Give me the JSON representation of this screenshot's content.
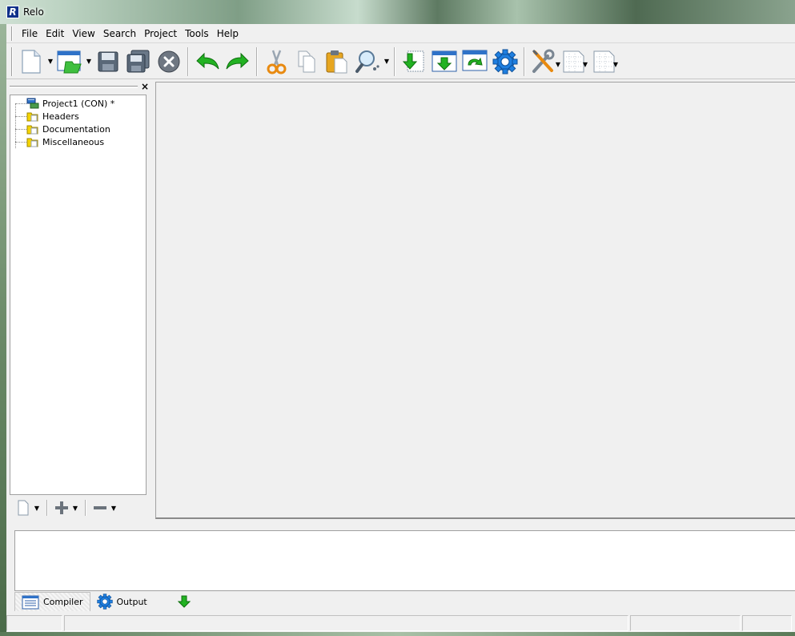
{
  "window": {
    "title": "Relo",
    "logo_letter": "R"
  },
  "menu": [
    "File",
    "Edit",
    "View",
    "Search",
    "Project",
    "Tools",
    "Help"
  ],
  "toolbar": {
    "buttons": [
      "new-file",
      "open-file",
      "save",
      "save-all",
      "close",
      "undo",
      "redo",
      "cut",
      "copy",
      "paste",
      "find",
      "import",
      "export",
      "refresh",
      "compile",
      "tools",
      "options-a",
      "options-b"
    ]
  },
  "project_tree": {
    "root": "Project1 (CON) *",
    "folders": [
      "Headers",
      "Documentation",
      "Miscellaneous"
    ]
  },
  "output_tabs": {
    "compiler": "Compiler",
    "output": "Output"
  },
  "colors": {
    "accent_green": "#1aa51a",
    "accent_blue": "#1f6fd1",
    "folder_yellow": "#f5d400"
  }
}
